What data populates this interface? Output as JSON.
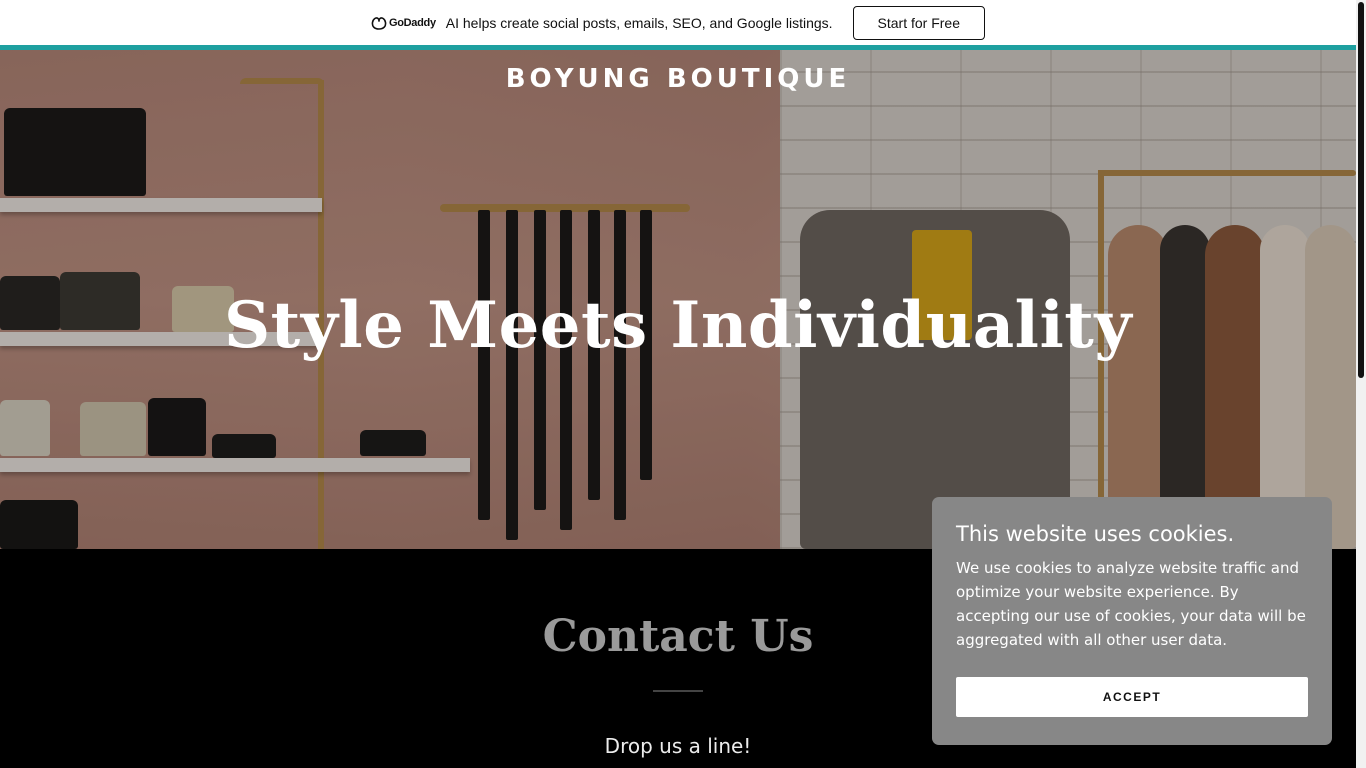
{
  "promo": {
    "logo_text": "GoDaddy",
    "message": "AI helps create social posts, emails, SEO, and Google listings.",
    "cta_label": "Start for Free"
  },
  "hero": {
    "site_title": "BOYUNG BOUTIQUE",
    "heading": "Style Meets Individuality"
  },
  "contact": {
    "title": "Contact Us",
    "subtitle": "Drop us a line!"
  },
  "cookie": {
    "title": "This website uses cookies.",
    "body": "We use cookies to analyze website traffic and optimize your website experience. By accepting our use of cookies, your data will be aggregated with all other user data.",
    "accept_label": "ACCEPT"
  },
  "colors": {
    "accent_line": "#1ea0a0",
    "cookie_bg": "#878787",
    "contact_bg": "#000000"
  },
  "icons": {
    "logo": "godaddy-logo-icon"
  }
}
